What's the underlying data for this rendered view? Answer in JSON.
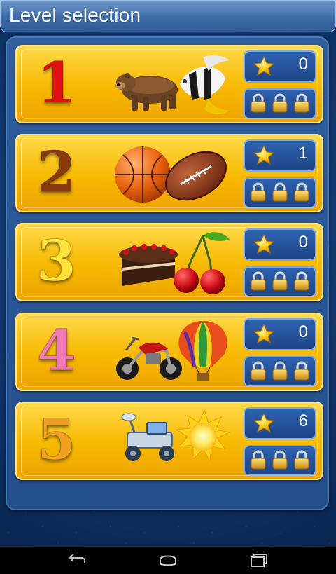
{
  "header": {
    "title": "Level selection"
  },
  "levels": [
    {
      "number": "1",
      "number_color": "#e01010",
      "art": [
        "bear",
        "angelfish"
      ],
      "stars": "0",
      "locks": 3
    },
    {
      "number": "2",
      "number_color": "#8a3a0c",
      "art": [
        "basketball",
        "american-football"
      ],
      "stars": "1",
      "locks": 3
    },
    {
      "number": "3",
      "number_color": "#ffe23a",
      "art": [
        "chocolate-cake",
        "cherries"
      ],
      "stars": "0",
      "locks": 3
    },
    {
      "number": "4",
      "number_color": "#f27ab8",
      "art": [
        "motorcycle",
        "hot-air-balloon"
      ],
      "stars": "0",
      "locks": 3
    },
    {
      "number": "5",
      "number_color": "#f0a020",
      "art": [
        "lunar-rover",
        "sun"
      ],
      "stars": "6",
      "locks": 3
    }
  ],
  "icons": {
    "score": "star-icon",
    "locked": "padlock-icon"
  },
  "navbar": {
    "buttons": [
      "back-icon",
      "home-icon",
      "recent-apps-icon"
    ]
  },
  "colors": {
    "card": "#f7b900",
    "box": "#1d4487",
    "header": "#3f6ca8"
  }
}
